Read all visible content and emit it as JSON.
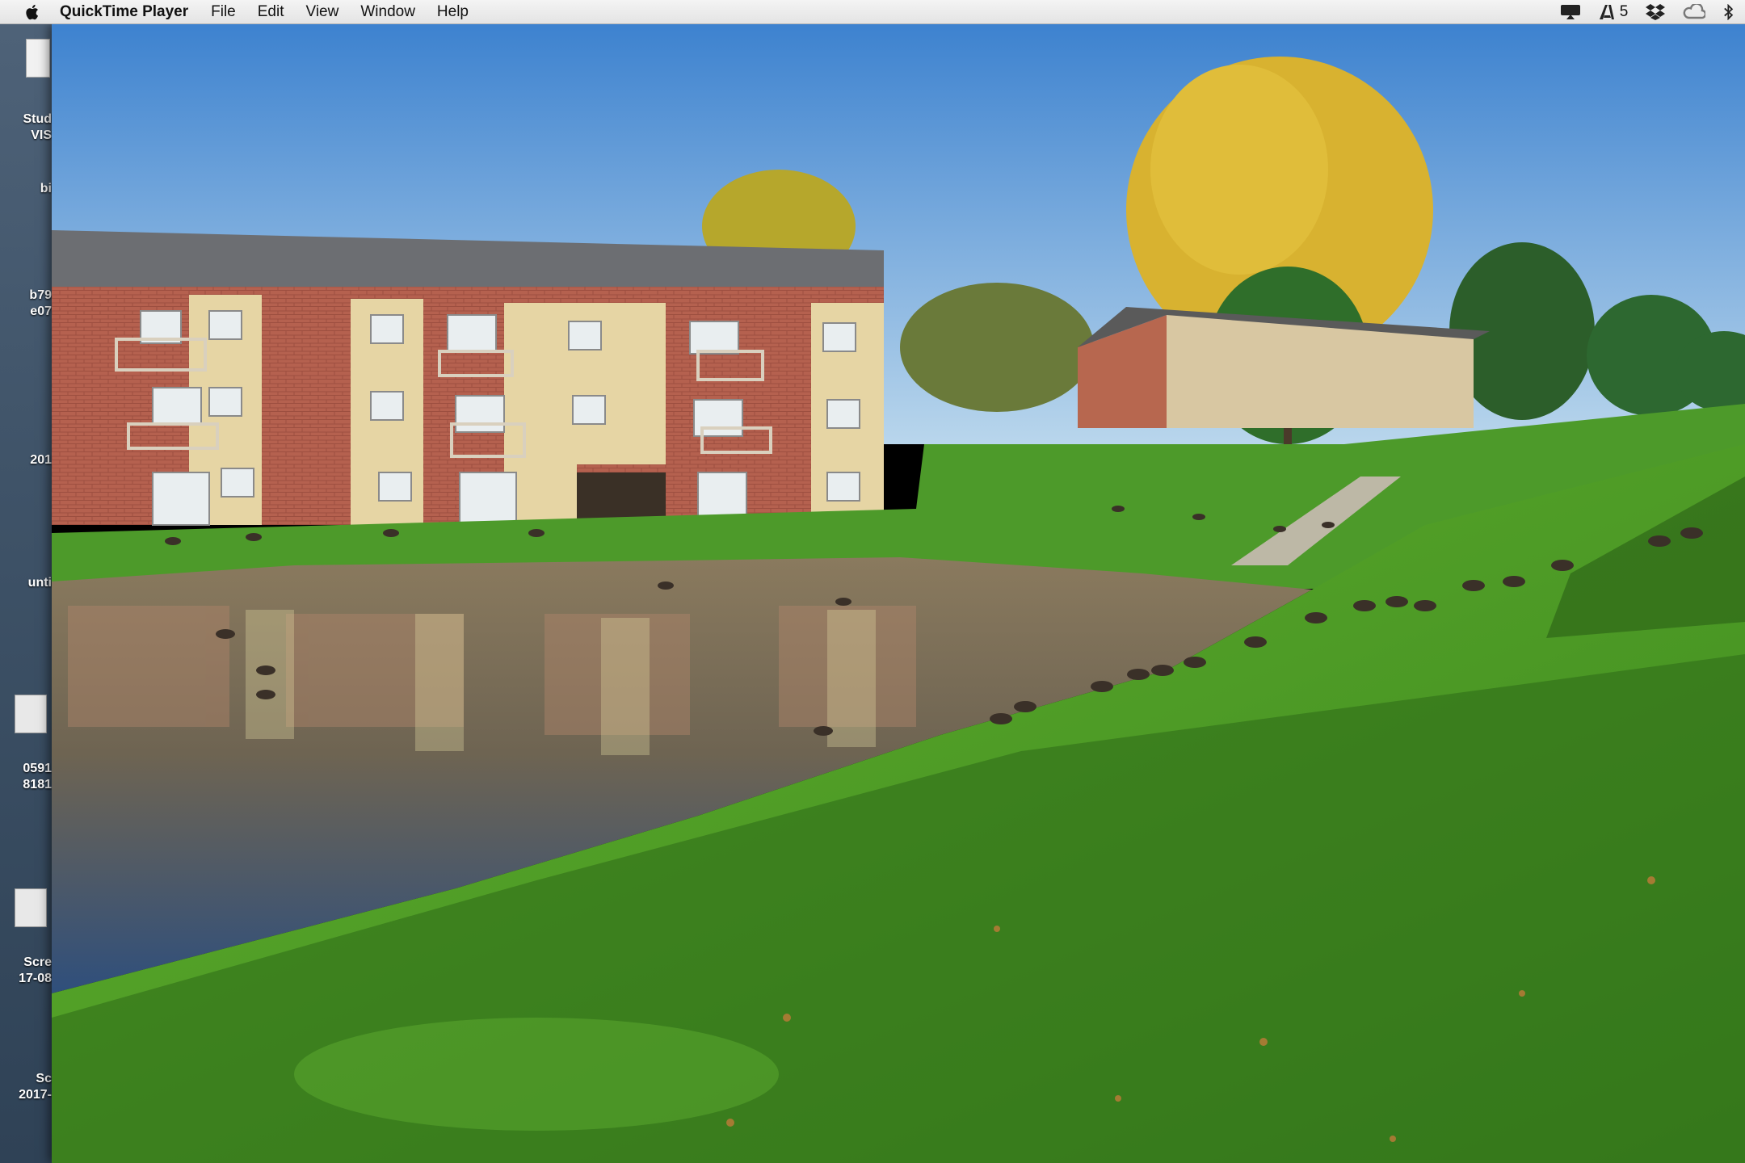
{
  "menubar": {
    "app_name": "QuickTime Player",
    "menus": [
      "File",
      "Edit",
      "View",
      "Window",
      "Help"
    ],
    "adobe_count": "5"
  },
  "desktop": {
    "labels": [
      "Stud",
      "VIS",
      "bi",
      "b79",
      "e07",
      "201",
      "unti",
      "0591",
      "8181",
      "Scre",
      "17-08",
      "Sc",
      "2017-"
    ]
  },
  "icons": {
    "apple": "apple-icon",
    "notification": "airplay-icon",
    "adobe": "adobe-icon",
    "dropbox": "dropbox-icon",
    "creative_cloud": "creative-cloud-icon",
    "bluetooth": "bluetooth-icon"
  },
  "colors": {
    "sky_top": "#3d82cf",
    "sky_bottom": "#b9d6ec",
    "grass": "#4f9a2a",
    "brick": "#b5614f",
    "water": "#7a6a52"
  }
}
